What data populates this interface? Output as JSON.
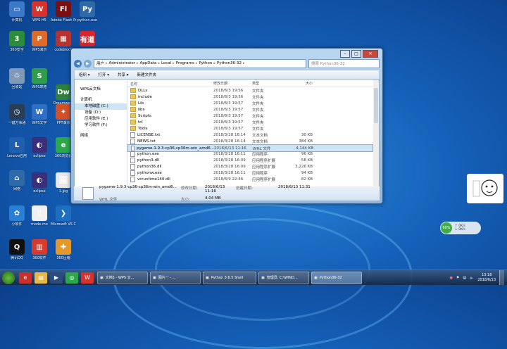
{
  "desktop": {
    "icons": [
      {
        "label": "计算机",
        "icon": "computer-icon",
        "color": "#3c78c8",
        "glyph": "▭"
      },
      {
        "label": "WPS H5",
        "icon": "wps-h5-icon",
        "color": "#d9322e",
        "glyph": "W"
      },
      {
        "label": "Adobe Flash Professio...",
        "icon": "adobe-flash-icon",
        "color": "#7a0f12",
        "glyph": "Fl"
      },
      {
        "label": "python.exe",
        "icon": "python-icon",
        "color": "#2f6aa6",
        "glyph": "Py"
      },
      {
        "label": "360安全",
        "icon": "360-security-icon",
        "color": "#2d8c3c",
        "glyph": "3"
      },
      {
        "label": "WPS演示",
        "icon": "wps-presentation-icon",
        "color": "#e06a2a",
        "glyph": "P"
      },
      {
        "label": "codeblock",
        "icon": "codeblocks-icon",
        "color": "#b7332f",
        "glyph": "▦"
      },
      {
        "label": "有道",
        "icon": "youdao-icon",
        "color": "#d8262d",
        "glyph": "有道"
      },
      {
        "label": "回收站",
        "icon": "recycle-bin-icon",
        "color": "#7f9ab8",
        "glyph": "♲"
      },
      {
        "label": "WPS表格",
        "icon": "wps-spreadsheet-icon",
        "color": "#2f9b4b",
        "glyph": "S"
      },
      {
        "label": "Dreamwe...",
        "icon": "dreamweaver-icon",
        "color": "#2f7f3f",
        "glyph": "Dw"
      },
      {
        "label": "一键万事通",
        "icon": "clock-app-icon",
        "color": "#2b3d55",
        "glyph": "◷"
      },
      {
        "label": "WPS文字",
        "icon": "wps-writer-icon",
        "color": "#2f6fc4",
        "glyph": "W"
      },
      {
        "label": "PPT演示",
        "icon": "ppt-tool-icon",
        "color": "#d0502a",
        "glyph": "✦"
      },
      {
        "label": "Lenovo应用",
        "icon": "lenovo-icon",
        "color": "#1f5fae",
        "glyph": "L"
      },
      {
        "label": "eclipse",
        "icon": "eclipse-icon",
        "color": "#3b2f7a",
        "glyph": "◐"
      },
      {
        "label": "360浏览器",
        "icon": "360-browser-icon",
        "color": "#2aa84a",
        "glyph": "e"
      },
      {
        "label": "网络",
        "icon": "network-icon",
        "color": "#2f6aa6",
        "glyph": "⌂"
      },
      {
        "label": "eclipse",
        "icon": "eclipse-icon-2",
        "color": "#3b2f7a",
        "glyph": "◐"
      },
      {
        "label": "1.jpg",
        "icon": "image-file-icon",
        "color": "#e8e8e8",
        "glyph": "🖼"
      },
      {
        "label": "小软件",
        "icon": "app-icon",
        "color": "#2a7fd4",
        "glyph": "✿"
      },
      {
        "label": "mode.mo",
        "icon": "file-icon",
        "color": "#f0f0f0",
        "glyph": "▯"
      },
      {
        "label": "Microsoft VS Cod...",
        "icon": "vscode-icon",
        "color": "#1f6fc0",
        "glyph": "❯"
      },
      {
        "label": "腾讯QQ",
        "icon": "qq-icon",
        "color": "#111",
        "glyph": "Q"
      },
      {
        "label": "360软件",
        "icon": "360-software-icon",
        "color": "#d73a2e",
        "glyph": "▥"
      },
      {
        "label": "360压缩",
        "icon": "360-zip-icon",
        "color": "#e39a2a",
        "glyph": "✚"
      }
    ]
  },
  "explorer": {
    "breadcrumb": [
      "用户",
      "Administrator",
      "AppData",
      "Local",
      "Programs",
      "Python",
      "Python36-32"
    ],
    "search_placeholder": "搜索 Python36-32",
    "toolbar": [
      "组织 ▾",
      "打开 ▾",
      "共享 ▾",
      "新建文件夹"
    ],
    "nav_pane": [
      {
        "label": "WPS云文档",
        "sub": false,
        "sel": false
      },
      {
        "label": "",
        "gap": true
      },
      {
        "label": "计算机",
        "sub": false,
        "sel": false
      },
      {
        "label": "本地磁盘 (C:)",
        "sub": true,
        "sel": true
      },
      {
        "label": "设备 (D:)",
        "sub": true,
        "sel": false
      },
      {
        "label": "应用软件 (E:)",
        "sub": true,
        "sel": false
      },
      {
        "label": "学习软件 (F:)",
        "sub": true,
        "sel": false
      },
      {
        "label": "",
        "gap": true
      },
      {
        "label": "网络",
        "sub": false,
        "sel": false
      }
    ],
    "columns": {
      "name": "名称",
      "date": "修改日期",
      "type": "类型",
      "size": "大小"
    },
    "files": [
      {
        "name": "DLLs",
        "date": "2018/6/3 19:56",
        "type": "文件夹",
        "size": "",
        "kind": "folder"
      },
      {
        "name": "include",
        "date": "2018/6/3 19:56",
        "type": "文件夹",
        "size": "",
        "kind": "folder"
      },
      {
        "name": "Lib",
        "date": "2018/6/3 19:57",
        "type": "文件夹",
        "size": "",
        "kind": "folder"
      },
      {
        "name": "libs",
        "date": "2018/6/3 19:57",
        "type": "文件夹",
        "size": "",
        "kind": "folder"
      },
      {
        "name": "Scripts",
        "date": "2018/6/3 19:57",
        "type": "文件夹",
        "size": "",
        "kind": "folder"
      },
      {
        "name": "tcl",
        "date": "2018/6/3 19:57",
        "type": "文件夹",
        "size": "",
        "kind": "folder"
      },
      {
        "name": "Tools",
        "date": "2018/6/3 19:57",
        "type": "文件夹",
        "size": "",
        "kind": "folder"
      },
      {
        "name": "LICENSE.txt",
        "date": "2018/3/28 16:14",
        "type": "文本文档",
        "size": "30 KB",
        "kind": "file"
      },
      {
        "name": "NEWS.txt",
        "date": "2018/3/28 16:14",
        "type": "文本文档",
        "size": "384 KB",
        "kind": "file"
      },
      {
        "name": "pygame-1.9.3-cp36-cp36m-win_amd6...",
        "date": "2018/6/13 11:16",
        "type": "WHL 文件",
        "size": "4,144 KB",
        "kind": "file",
        "sel": true
      },
      {
        "name": "python.exe",
        "date": "2018/3/28 16:11",
        "type": "应用程序",
        "size": "96 KB",
        "kind": "file"
      },
      {
        "name": "python3.dll",
        "date": "2018/3/28 16:09",
        "type": "应用程序扩展",
        "size": "58 KB",
        "kind": "file"
      },
      {
        "name": "python36.dll",
        "date": "2018/3/28 16:09",
        "type": "应用程序扩展",
        "size": "3,226 KB",
        "kind": "file"
      },
      {
        "name": "pythonw.exe",
        "date": "2018/3/28 16:11",
        "type": "应用程序",
        "size": "94 KB",
        "kind": "file"
      },
      {
        "name": "vcruntime140.dll",
        "date": "2018/6/9 22:46",
        "type": "应用程序扩展",
        "size": "82 KB",
        "kind": "file"
      }
    ],
    "details": {
      "filename": "pygame-1.9.3-cp36-cp36m-win_amd6...",
      "filetype": "WHL 文件",
      "modified_label": "修改日期:",
      "modified_value": "2018/6/13 11:16",
      "created_label": "创建日期:",
      "created_value": "2018/6/13 11:31",
      "size_label": "大小:",
      "size_value": "4.04 MB"
    }
  },
  "widgets": {
    "net_percent": "60%",
    "net_up": "0K/s",
    "net_down": "0K/s"
  },
  "taskbar": {
    "tasks": [
      {
        "label": "文档1 - WPS 文...",
        "active": false
      },
      {
        "label": "图片一 - ...",
        "active": false
      },
      {
        "label": "Python 3.6.5 Shell",
        "active": false
      },
      {
        "label": "管理员: C:\\WIND...",
        "active": false
      },
      {
        "label": "Python36-32",
        "active": true
      }
    ],
    "time": "13:18",
    "date": "2018/6/13"
  }
}
